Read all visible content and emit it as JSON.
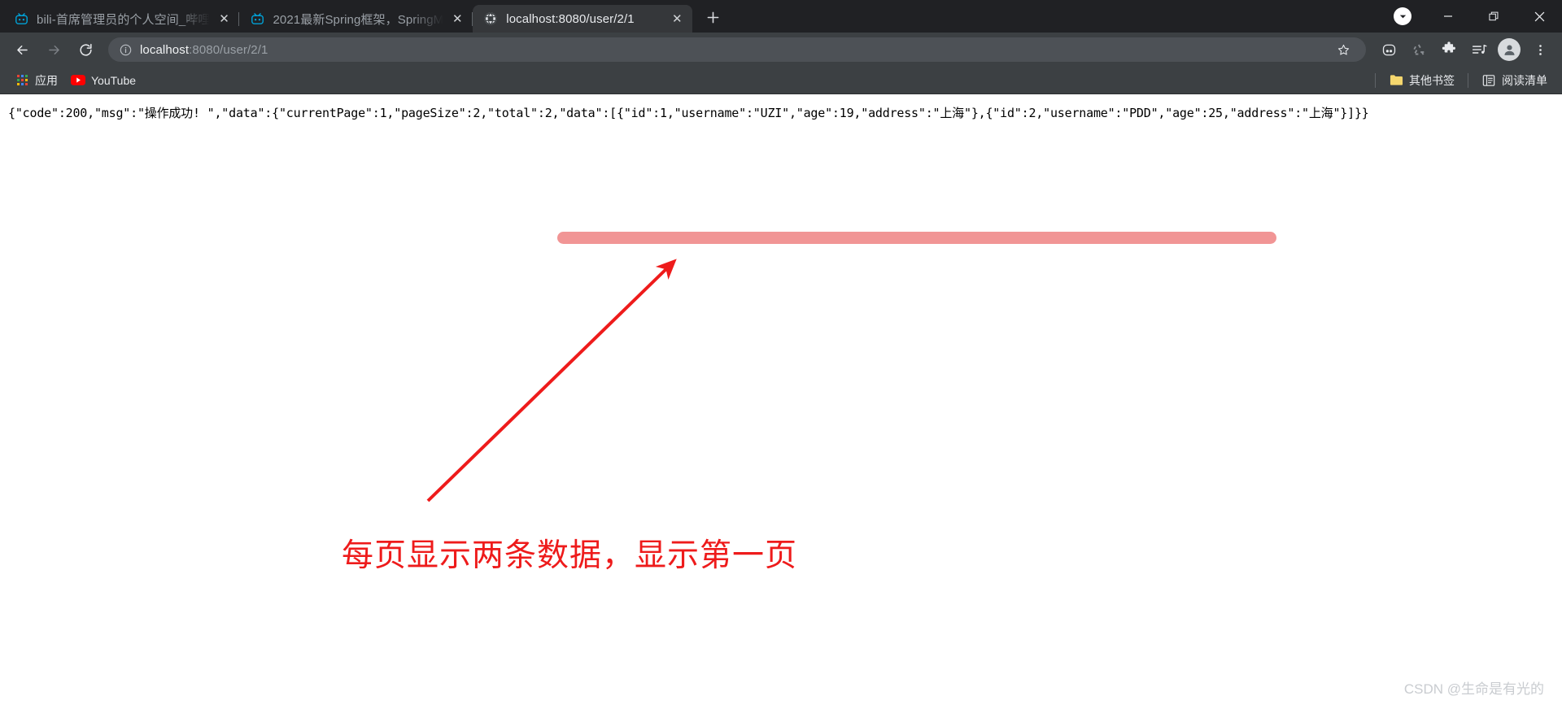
{
  "window": {
    "controls": {
      "download_label": "▼",
      "minimize_label": "—",
      "restore_label": "❐",
      "close_label": "✕"
    }
  },
  "tabstrip": {
    "new_tab_label": "+",
    "tabs": [
      {
        "title": "bili-首席管理员的个人空间_哔哩",
        "favicon": "bilibili-tv-icon",
        "close_label": "✕",
        "active": false
      },
      {
        "title": "2021最新Spring框架，SpringM",
        "favicon": "bilibili-tv-icon",
        "close_label": "✕",
        "active": false
      },
      {
        "title": "localhost:8080/user/2/1",
        "favicon": "globe-icon",
        "close_label": "✕",
        "active": true
      }
    ]
  },
  "toolbar": {
    "back_label": "←",
    "forward_label": "→",
    "reload_label": "⟳",
    "url_host": "localhost",
    "url_path": ":8080/user/2/1",
    "url_full": "localhost:8080/user/2/1",
    "site_info_label": "ⓘ",
    "bookmark_star_label": "☆",
    "icons": [
      "pocket-icon",
      "recycle-icon",
      "extensions-puzzle-icon",
      "media-playlist-icon"
    ],
    "avatar_label": "profile-avatar",
    "menu_label": "⋮"
  },
  "bookmarks_bar": {
    "items": [
      {
        "label": "应用",
        "icon": "apps-grid-icon"
      },
      {
        "label": "YouTube",
        "icon": "youtube-icon"
      }
    ],
    "right_items": [
      {
        "label": "其他书签",
        "icon": "folder-icon"
      },
      {
        "label": "阅读清单",
        "icon": "reading-list-icon"
      }
    ]
  },
  "page": {
    "response_text": "{\"code\":200,\"msg\":\"操作成功! \",\"data\":{\"currentPage\":1,\"pageSize\":2,\"total\":2,\"data\":[{\"id\":1,\"username\":\"UZI\",\"age\":19,\"address\":\"上海\"},{\"id\":2,\"username\":\"PDD\",\"age\":25,\"address\":\"上海\"}]}}",
    "response_json": {
      "code": 200,
      "msg": "操作成功! ",
      "data": {
        "currentPage": 1,
        "pageSize": 2,
        "total": 2,
        "data": [
          {
            "id": 1,
            "username": "UZI",
            "age": 19,
            "address": "上海"
          },
          {
            "id": 2,
            "username": "PDD",
            "age": 25,
            "address": "上海"
          }
        ]
      }
    }
  },
  "annotations": {
    "highlight_color": "#f08c8c",
    "arrow_color": "#ee1b1b",
    "note_text": "每页显示两条数据，显示第一页",
    "note_color": "#ee1b1b",
    "watermark": "CSDN @生命是有光的"
  }
}
